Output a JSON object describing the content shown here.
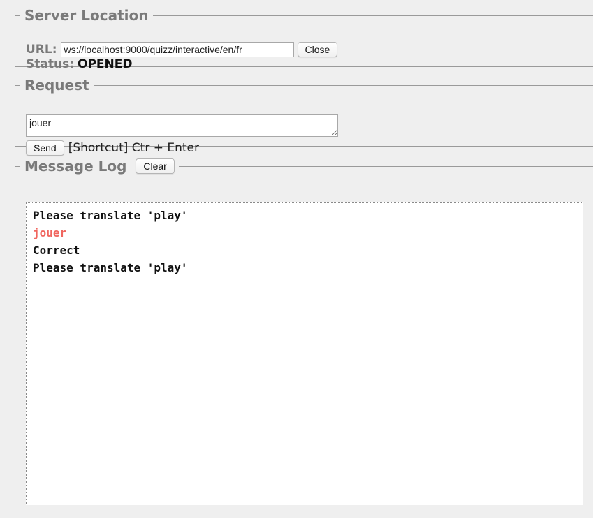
{
  "server_location": {
    "legend": "Server Location",
    "url_label": "URL:",
    "url_value": "ws://localhost:9000/quizz/interactive/en/fr",
    "close_label": "Close",
    "status_label": "Status:",
    "status_value": "OPENED"
  },
  "request": {
    "legend": "Request",
    "text_value": "jouer",
    "send_label": "Send",
    "shortcut_hint": "[Shortcut] Ctr + Enter"
  },
  "message_log": {
    "legend": "Message Log",
    "clear_label": "Clear",
    "messages": [
      {
        "text": "Please translate 'play'",
        "kind": "received"
      },
      {
        "text": "jouer",
        "kind": "sent"
      },
      {
        "text": "Correct",
        "kind": "received"
      },
      {
        "text": "Please translate 'play'",
        "kind": "received"
      }
    ]
  },
  "colors": {
    "sent_message": "#f0665f",
    "legend_text": "#7a7a7a"
  }
}
